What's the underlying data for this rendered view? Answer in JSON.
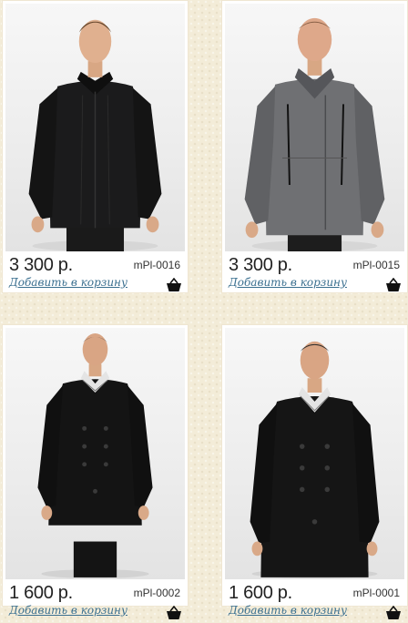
{
  "products": [
    {
      "price": "3 300 р.",
      "sku": "mPl-0016",
      "cart_label": "Добавить в корзину",
      "coat_color": "#1b1b1c",
      "style": "single-breasted zip coat"
    },
    {
      "price": "3 300 р.",
      "sku": "mPl-0015",
      "cart_label": "Добавить в корзину",
      "coat_color": "#6f7073",
      "style": "grey double-breasted coat"
    },
    {
      "price": "1 600 р.",
      "sku": "mPl-0002",
      "cart_label": "Добавить в корзину",
      "coat_color": "#141414",
      "style": "black double-breasted long coat"
    },
    {
      "price": "1 600 р.",
      "sku": "mPl-0001",
      "cart_label": "Добавить в корзину",
      "coat_color": "#151515",
      "style": "black double-breasted coat"
    }
  ],
  "icons": {
    "cart": "basket-icon"
  },
  "colors": {
    "link": "#3a6f8f",
    "background": "#f3ecd8",
    "card": "#ffffff"
  }
}
